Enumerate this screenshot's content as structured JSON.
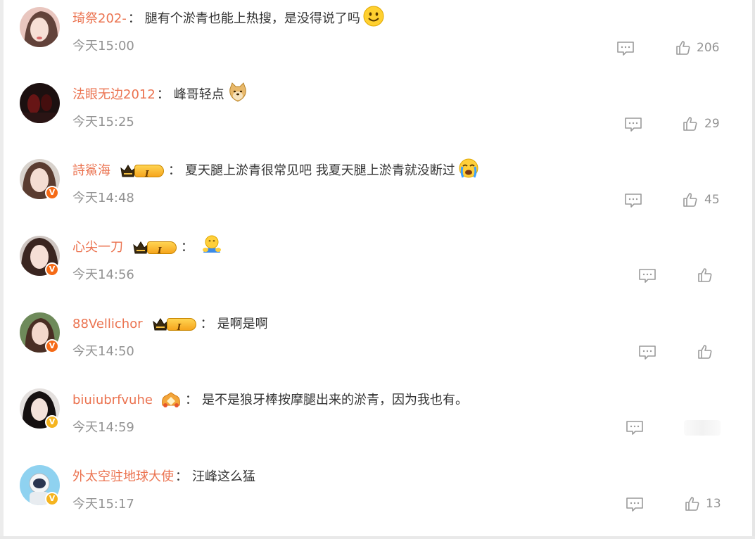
{
  "comments": [
    {
      "username": "琦祭202-",
      "colon": "：",
      "text": "腿有个淤青也能上热搜，是没得说了吗",
      "emoji": "smile-emoji",
      "time": "今天15:00",
      "likes": "206",
      "badge": "none",
      "verified": "none"
    },
    {
      "username": "法眼无边2012",
      "colon": "：",
      "text": "峰哥轻点",
      "emoji": "doge-emoji",
      "time": "今天15:25",
      "likes": "29",
      "badge": "none",
      "verified": "none"
    },
    {
      "username": "詩鯊海",
      "colon": "：",
      "text": "夏天腿上淤青很常见吧 我夏天腿上淤青就没断过",
      "emoji": "crying-emoji",
      "time": "今天14:48",
      "likes": "45",
      "badge": "crown-level-1",
      "badge_level": "I",
      "verified": "orange"
    },
    {
      "username": "心尖一刀",
      "colon": "：",
      "text": "",
      "emoji": "hug-emoji",
      "time": "今天14:56",
      "likes": "",
      "badge": "crown-level-1",
      "badge_level": "I",
      "verified": "orange"
    },
    {
      "username": "88Vellichor",
      "colon": "：",
      "text": "是啊是啊",
      "emoji": "",
      "time": "今天14:50",
      "likes": "",
      "badge": "crown-level-1",
      "badge_level": "I",
      "verified": "orange"
    },
    {
      "username": "biuiubrfvuhe",
      "colon": "：",
      "text": "是不是狼牙棒按摩腿出来的淤青，因为我也有。",
      "emoji": "",
      "time": "今天14:59",
      "likes": "",
      "badge": "fan-badge",
      "verified": "yellow"
    },
    {
      "username": "外太空驻地球大使",
      "colon": "：",
      "text": "汪峰这么猛",
      "emoji": "",
      "time": "今天15:17",
      "likes": "13",
      "badge": "none",
      "verified": "yellow"
    }
  ],
  "verified_mark": "V",
  "colors": {
    "username": "#eb7350",
    "text": "#333333",
    "meta": "#939393",
    "verified_orange": "#f56a16",
    "verified_yellow": "#f5b41f"
  }
}
